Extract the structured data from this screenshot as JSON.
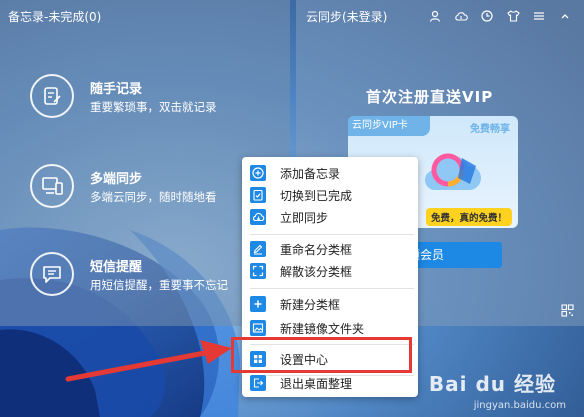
{
  "memo_panel": {
    "header": "备忘录-未完成(0)",
    "features": [
      {
        "title": "随手记录",
        "desc": "重要繁琐事，双击就记录"
      },
      {
        "title": "多端同步",
        "desc": "多端云同步，随时随地看"
      },
      {
        "title": "短信提醒",
        "desc": "用短信提醒，重要事不忘记"
      }
    ]
  },
  "sync_panel": {
    "header": "云同步(未登录)",
    "toolbar_icons": [
      "user-icon",
      "cloud-upload-icon",
      "clock-icon",
      "shirt-icon",
      "menu-icon",
      "chevron-up-icon"
    ],
    "promo_title": "首次注册直送VIP",
    "vip_card_tab": "云同步VIP卡",
    "free_tag": "免费畅享",
    "free_banner": "免费，真的免费！",
    "claim_button": "领会员"
  },
  "context_menu": {
    "items": [
      {
        "label": "添加备忘录",
        "icon": "plus-circle-icon"
      },
      {
        "label": "切换到已完成",
        "icon": "check-clipboard-icon"
      },
      {
        "label": "立即同步",
        "icon": "cloud-sync-icon"
      },
      {
        "label": "重命名分类框",
        "icon": "pencil-icon"
      },
      {
        "label": "解散该分类框",
        "icon": "expand-icon"
      },
      {
        "label": "新建分类框",
        "icon": "plus-square-icon"
      },
      {
        "label": "新建镜像文件夹",
        "icon": "image-folder-icon"
      },
      {
        "label": "设置中心",
        "icon": "grid-icon"
      },
      {
        "label": "退出桌面整理",
        "icon": "exit-icon"
      }
    ],
    "highlighted": "设置中心"
  },
  "watermark": {
    "brand": "Bai du 经验",
    "sub": "jingyan.baidu.com"
  },
  "colors": {
    "accent": "#1e88e5",
    "highlight": "#e53935",
    "banner": "#ffd21f"
  }
}
